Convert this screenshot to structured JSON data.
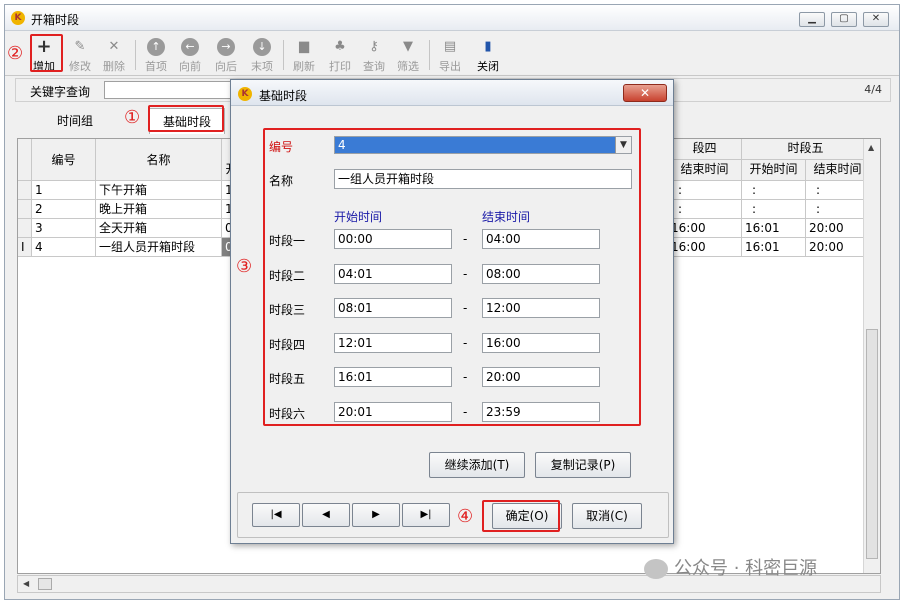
{
  "window": {
    "title": "开箱时段"
  },
  "toolbar": {
    "add": "增加",
    "edit": "修改",
    "delete": "删除",
    "first": "首项",
    "prev": "向前",
    "next": "向后",
    "last": "末项",
    "refresh": "刷新",
    "print": "打印",
    "query": "查询",
    "filter": "筛选",
    "export": "导出",
    "close": "关闭"
  },
  "search": {
    "label": "关键字查询",
    "value": "",
    "page_indicator": "4/4"
  },
  "tabs": [
    {
      "label": "时间组"
    },
    {
      "label": "基础时段"
    }
  ],
  "callouts": {
    "c1": "①",
    "c2": "②",
    "c3": "③",
    "c4": "④"
  },
  "grid": {
    "headers": {
      "id": "编号",
      "name": "名称",
      "col_partial": "开",
      "p4": "段四",
      "p5": "时段五",
      "end": "结束时间",
      "start": "开始时间"
    },
    "rows": [
      {
        "id": "1",
        "name": "下午开箱",
        "start1": "12",
        "p4_end": ":",
        "p5_start": ":",
        "p5_end": ":"
      },
      {
        "id": "2",
        "name": "晚上开箱",
        "start1": "17",
        "p4_end": ":",
        "p5_start": ":",
        "p5_end": ":"
      },
      {
        "id": "3",
        "name": "全天开箱",
        "start1": "00",
        "p4_end": "16:00",
        "p5_start": "16:01",
        "p5_end": "20:00",
        "more": "2"
      },
      {
        "id": "4",
        "name": "一组人员开箱时段",
        "start1": "00",
        "p4_end": "16:00",
        "p5_start": "16:01",
        "p5_end": "20:00",
        "more": "2"
      }
    ]
  },
  "dialog": {
    "title": "基础时段",
    "close": "✕",
    "id_label": "编号",
    "id_value": "4",
    "name_label": "名称",
    "name_value": "一组人员开箱时段",
    "start_header": "开始时间",
    "end_header": "结束时间",
    "dash": "-",
    "periods": [
      {
        "label": "时段一",
        "start": "00:00",
        "end": "04:00"
      },
      {
        "label": "时段二",
        "start": "04:01",
        "end": "08:00"
      },
      {
        "label": "时段三",
        "start": "08:01",
        "end": "12:00"
      },
      {
        "label": "时段四",
        "start": "12:01",
        "end": "16:00"
      },
      {
        "label": "时段五",
        "start": "16:01",
        "end": "20:00"
      },
      {
        "label": "时段六",
        "start": "20:01",
        "end": "23:59"
      }
    ],
    "continue_add": "继续添加(T)",
    "copy_record": "复制记录(P)",
    "ok": "确定(O)",
    "cancel": "取消(C)",
    "nav": {
      "first": "|◀",
      "prev": "◀",
      "next": "▶",
      "last": "▶|"
    }
  },
  "watermark": "公众号 · 科密巨源"
}
